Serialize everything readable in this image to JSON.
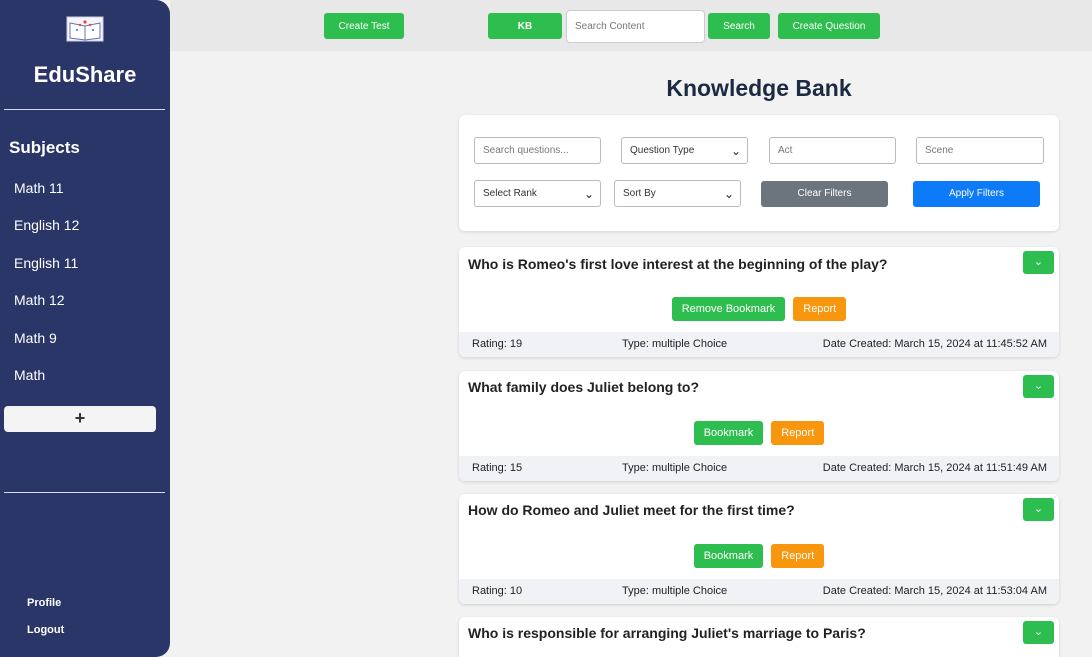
{
  "sidebar": {
    "brand": "EduShare",
    "subjects_title": "Subjects",
    "subjects": [
      "Math 11",
      "English 12",
      "English 11",
      "Math 12",
      "Math 9",
      "Math"
    ],
    "add_label": "+",
    "profile": "Profile",
    "logout": "Logout"
  },
  "topbar": {
    "create_test": "Create Test",
    "kb": "KB",
    "search_placeholder": "Search Content",
    "search": "Search",
    "create_question": "Create Question"
  },
  "page_title": "Knowledge Bank",
  "filters": {
    "search_placeholder": "Search questions...",
    "question_type": "Question Type",
    "act_placeholder": "Act",
    "scene_placeholder": "Scene",
    "rank": "Select Rank",
    "sort": "Sort By",
    "clear": "Clear Filters",
    "apply": "Apply Filters"
  },
  "questions": [
    {
      "text": "Who is Romeo's first love interest at the beginning of the play?",
      "bookmark": "Remove Bookmark",
      "report": "Report",
      "rating": "Rating: 19",
      "type": "Type: multiple Choice",
      "date": "Date Created: March 15, 2024 at 11:45:52 AM"
    },
    {
      "text": "What family does Juliet belong to?",
      "bookmark": "Bookmark",
      "report": "Report",
      "rating": "Rating: 15",
      "type": "Type: multiple Choice",
      "date": "Date Created: March 15, 2024 at 11:51:49 AM"
    },
    {
      "text": "How do Romeo and Juliet meet for the first time?",
      "bookmark": "Bookmark",
      "report": "Report",
      "rating": "Rating: 10",
      "type": "Type: multiple Choice",
      "date": "Date Created: March 15, 2024 at 11:53:04 AM"
    },
    {
      "text": "Who is responsible for arranging Juliet's marriage to Paris?"
    }
  ],
  "colors": {
    "sidebar": "#2b3668",
    "green": "#2ebd4f",
    "orange": "#f8960d",
    "blue": "#0d7af8",
    "gray": "#6c757d"
  },
  "icons": {
    "logo": "book-logo-icon",
    "expand": "chevron-down-icon",
    "select": "chevron-down-icon"
  }
}
